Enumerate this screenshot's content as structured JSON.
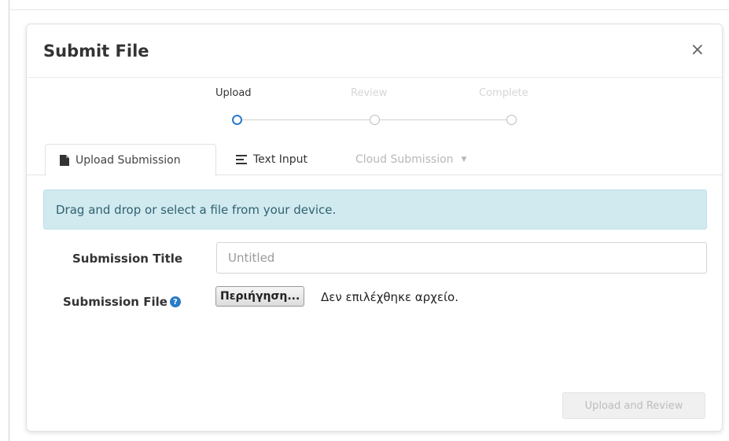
{
  "modal": {
    "title": "Submit File",
    "close_label": "×"
  },
  "stepper": {
    "steps": [
      {
        "label": "Upload",
        "state": "active"
      },
      {
        "label": "Review",
        "state": "inactive"
      },
      {
        "label": "Complete",
        "state": "inactive"
      }
    ]
  },
  "tabs": [
    {
      "label": "Upload Submission",
      "icon": "file-icon",
      "active": true
    },
    {
      "label": "Text Input",
      "icon": "align-left-icon",
      "active": false
    },
    {
      "label": "Cloud Submission",
      "icon": "caret-down-icon",
      "active": false,
      "disabled": true
    }
  ],
  "alert": {
    "text": "Drag and drop or select a file from your device."
  },
  "form": {
    "title_label": "Submission Title",
    "title_placeholder": "Untitled",
    "file_label": "Submission File",
    "help_icon": "?",
    "browse_label": "Περιήγηση...",
    "file_status": "Δεν επιλέχθηκε αρχείο."
  },
  "actions": {
    "submit_label": "Upload and Review"
  },
  "colors": {
    "accent": "#2a7bc8",
    "alert_bg": "#d0eaf0",
    "alert_text": "#31616e"
  }
}
